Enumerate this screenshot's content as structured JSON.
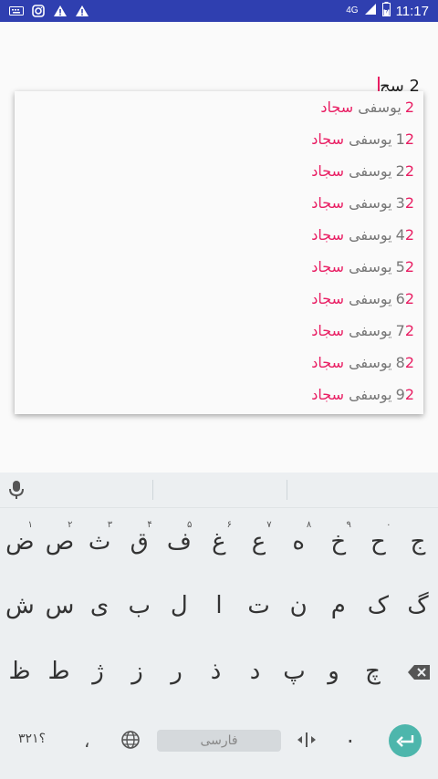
{
  "status_bar": {
    "time": "11:17",
    "network": "4G",
    "battery_level": 0.5,
    "left_icons": [
      "keyboard-icon",
      "instagram-icon",
      "warning-icon",
      "warning-icon"
    ]
  },
  "input": {
    "value": "2 سج"
  },
  "suggestions": [
    {
      "num": "2",
      "rest": "",
      "match": "سجاد",
      "rest_name": "یوسفی"
    },
    {
      "num": "1",
      "rest": "2",
      "match": "سجاد",
      "rest_name": "یوسفی"
    },
    {
      "num": "2",
      "rest": "2",
      "match": "سجاد",
      "rest_name": "یوسفی"
    },
    {
      "num": "3",
      "rest": "2",
      "match": "سجاد",
      "rest_name": "یوسفی"
    },
    {
      "num": "4",
      "rest": "2",
      "match": "سجاد",
      "rest_name": "یوسفی"
    },
    {
      "num": "5",
      "rest": "2",
      "match": "سجاد",
      "rest_name": "یوسفی"
    },
    {
      "num": "6",
      "rest": "2",
      "match": "سجاد",
      "rest_name": "یوسفی"
    },
    {
      "num": "7",
      "rest": "2",
      "match": "سجاد",
      "rest_name": "یوسفی"
    },
    {
      "num": "8",
      "rest": "2",
      "match": "سجاد",
      "rest_name": "یوسفی"
    },
    {
      "num": "9",
      "rest": "2",
      "match": "سجاد",
      "rest_name": "یوسفی"
    }
  ],
  "keyboard": {
    "row1": [
      {
        "k": "ض",
        "h": "۱"
      },
      {
        "k": "ص",
        "h": "۲"
      },
      {
        "k": "ث",
        "h": "۳"
      },
      {
        "k": "ق",
        "h": "۴"
      },
      {
        "k": "ف",
        "h": "۵"
      },
      {
        "k": "غ",
        "h": "۶"
      },
      {
        "k": "ع",
        "h": "۷"
      },
      {
        "k": "ه",
        "h": "۸"
      },
      {
        "k": "خ",
        "h": "۹"
      },
      {
        "k": "ح",
        "h": "۰"
      },
      {
        "k": "ج",
        "h": ""
      }
    ],
    "row2": [
      "ش",
      "س",
      "ی",
      "ب",
      "ل",
      "ا",
      "ت",
      "ن",
      "م",
      "ک",
      "گ"
    ],
    "row3": [
      "ظ",
      "ط",
      "ژ",
      "ز",
      "ر",
      "ذ",
      "د",
      "پ",
      "و",
      "چ"
    ],
    "bottom": {
      "numbers_label": "؟۳۲۱",
      "comma": "،",
      "space_label": "فارسی",
      "period": "."
    }
  }
}
